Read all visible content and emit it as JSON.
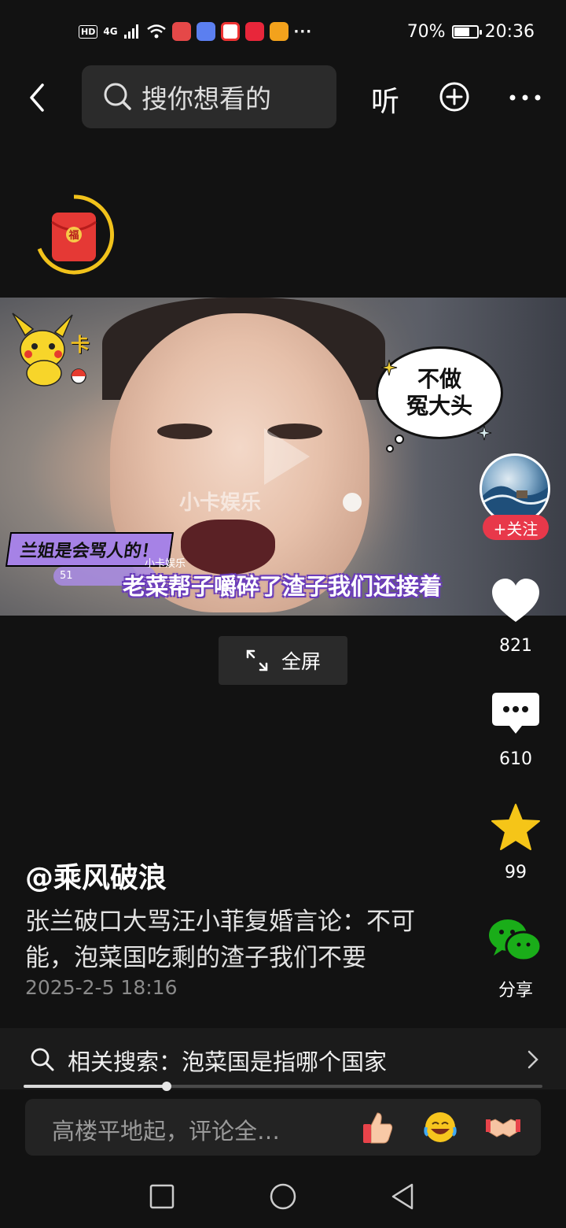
{
  "status_bar": {
    "hd": "HD",
    "network": "4G",
    "battery": "70%",
    "battery_level": 0.7,
    "time": "20:36",
    "more": "···"
  },
  "top_nav": {
    "search_placeholder": "搜你想看的",
    "listen_label": "听"
  },
  "video": {
    "bubble_line1": "不做",
    "bubble_line2": "冤大头",
    "watermark": "小卡娱乐",
    "small_watermark": "小卡娱乐",
    "tag_text": "兰姐是会骂人的！",
    "sticker_text": "卡",
    "live_badge": "51",
    "subtitle": "老菜帮子嚼碎了渣子我们还接着",
    "fullscreen_label": "全屏"
  },
  "actions": {
    "follow_label": "+关注",
    "likes": "821",
    "comments": "610",
    "favorites": "99",
    "share_label": "分享"
  },
  "post": {
    "author": "@乘风破浪",
    "description": "张兰破口大骂汪小菲复婚言论：不可能，泡菜国吃剩的渣子我们不要",
    "date": "2025-2-5 18:16"
  },
  "related_search": {
    "text": "相关搜索：泡菜国是指哪个国家"
  },
  "playback": {
    "progress": 0.275
  },
  "comment_bar": {
    "placeholder": "高楼平地起，评论全…"
  },
  "colors": {
    "background": "#121212",
    "follow_red": "#e8384a",
    "star_yellow": "#f5c518",
    "wechat_green": "#1aad19"
  }
}
